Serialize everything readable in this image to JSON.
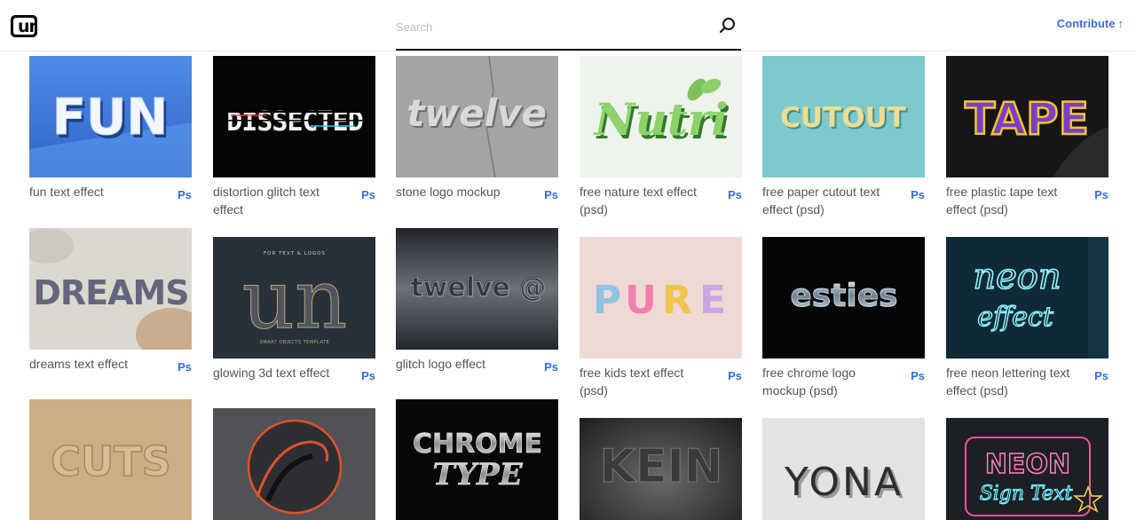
{
  "header": {
    "logo_text": "un",
    "search_placeholder": "Search",
    "contribute_label": "Contribute",
    "contribute_arrow": "↑"
  },
  "badge_label": "Ps",
  "cards": [
    {
      "title": "fun text effect",
      "art": "FUN"
    },
    {
      "title": "distortion glitch text effect",
      "art": "DISSECTED"
    },
    {
      "title": "stone logo mockup",
      "art": "twelve"
    },
    {
      "title": "free nature text effect (psd)",
      "art": "Nutri"
    },
    {
      "title": "free paper cutout text effect (psd)",
      "art": "CUTOUT"
    },
    {
      "title": "free plastic tape text effect (psd)",
      "art": "TAPE"
    },
    {
      "title": "dreams text effect",
      "art": "DREAMS"
    },
    {
      "title": "glowing 3d text effect",
      "art": "un",
      "art_top": "FOR TEXT & LOGOS",
      "art_bottom": "SMART OBJECTS TEMPLATE"
    },
    {
      "title": "glitch logo effect",
      "art": "twelve @"
    },
    {
      "title": "free kids text effect (psd)",
      "art": "PURE"
    },
    {
      "title": "free chrome logo mockup (psd)",
      "art": "esties"
    },
    {
      "title": "free neon lettering text effect (psd)",
      "art": "neon",
      "art2": "effect"
    },
    {
      "title": "",
      "art": "CUTS"
    },
    {
      "title": "",
      "art": ""
    },
    {
      "title": "",
      "art": "CHROME",
      "art2": "TYPE"
    },
    {
      "title": "",
      "art": "KEIN"
    },
    {
      "title": "",
      "art": "YONA"
    },
    {
      "title": "",
      "art": "NEON",
      "art2": "Sign Text"
    }
  ]
}
